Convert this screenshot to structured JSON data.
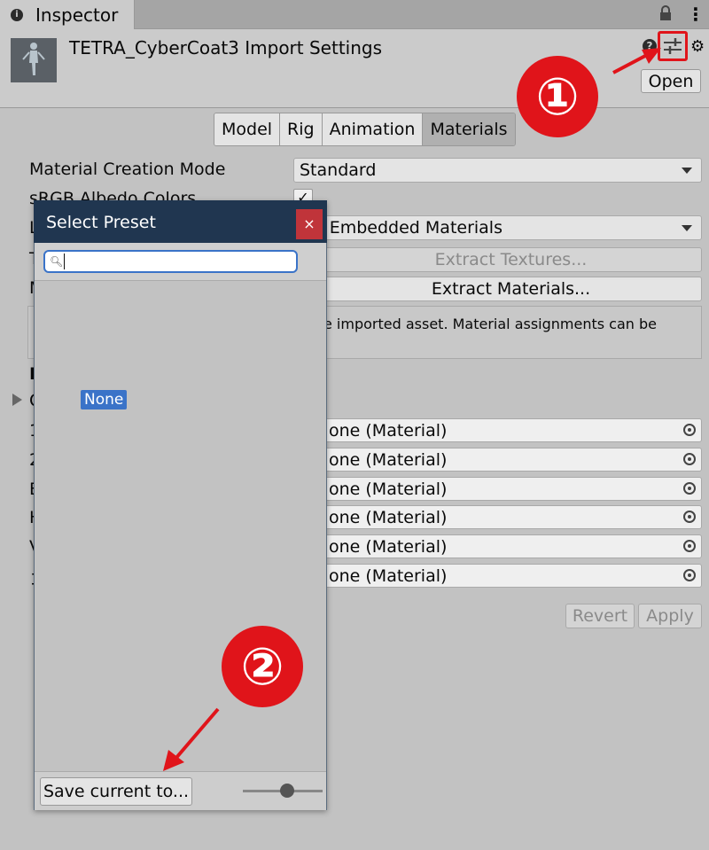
{
  "tab": {
    "label": "Inspector"
  },
  "header": {
    "title": "TETRA_CyberCoat3 Import Settings",
    "open_label": "Open"
  },
  "tabs": [
    {
      "label": "Model",
      "active": false
    },
    {
      "label": "Rig",
      "active": false
    },
    {
      "label": "Animation",
      "active": false
    },
    {
      "label": "Materials",
      "active": true
    }
  ],
  "settings": {
    "material_creation_mode_label": "Material Creation Mode",
    "material_creation_mode_value": "Standard",
    "srgb_label": "sRGB Albedo Colors",
    "location_label_fragment": "L",
    "location_value": "Use Embedded Materials",
    "location_value_visible": "e Embedded Materials",
    "textures_label_fragment": "T",
    "extract_textures_label": "Extract Textures...",
    "materials_label_fragment": "M",
    "extract_materials_label": "Extract Materials...",
    "help_text": "e imported asset. Material assignments can be",
    "remapped_label_fragment": "R",
    "on_demand_fragment": "O"
  },
  "remap": {
    "rows": [
      {
        "label_fragment": "1",
        "value": "one (Material)"
      },
      {
        "label_fragment": "2",
        "value": "one (Material)"
      },
      {
        "label_fragment": "E",
        "value": "one (Material)"
      },
      {
        "label_fragment": "H",
        "value": "one (Material)"
      },
      {
        "label_fragment": "V",
        "value": "one (Material)"
      },
      {
        "label_fragment": "コ",
        "value": "one (Material)"
      }
    ]
  },
  "footer": {
    "revert_label": "Revert",
    "apply_label": "Apply"
  },
  "popup": {
    "title": "Select Preset",
    "close_label": "×",
    "search_value": "",
    "items": [
      "None"
    ],
    "save_label": "Save current to...",
    "zoom": 0.55
  },
  "annotations": {
    "step1": "①",
    "step2": "②"
  },
  "colors": {
    "accent": "#3a73c8",
    "title_bar": "#203650",
    "close": "#c0343a",
    "annotation": "#e0141a"
  }
}
